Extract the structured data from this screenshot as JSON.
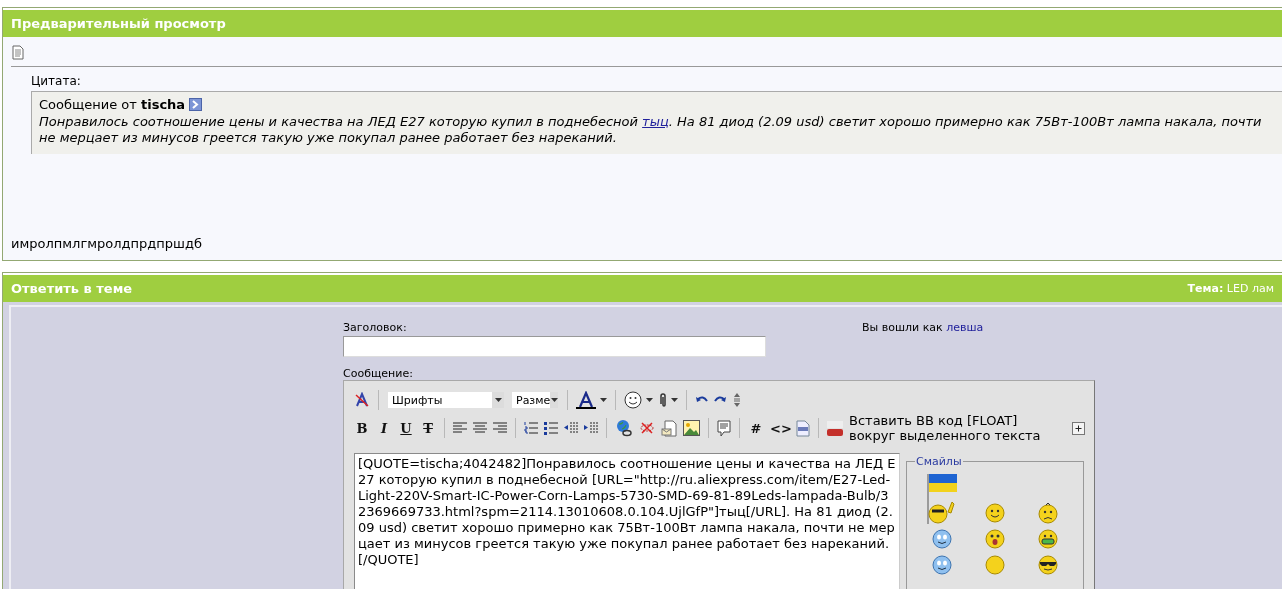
{
  "preview": {
    "title": "Предварительный просмотр",
    "quote_label": "Цитата:",
    "quote": {
      "from_label": "Сообщение от",
      "author": "tischa",
      "text_before": "Понравилось соотношение цены и качества на ЛЕД Е27 которую купил в поднебесной ",
      "link": "тыц",
      "text_after": ". На 81 диод (2.09 usd) светит хорошо примерно как 75Вт-100Вт лампа накала, почти не мерцает из минусов греется такую уже покупал ранее работает без нареканий."
    },
    "message": "имролпмлгмролдпрдпршдб"
  },
  "reply": {
    "title": "Ответить в теме",
    "topic": "**Тема:** LED лам",
    "title_label": "Заголовок:",
    "login_text": "Вы вошли как ",
    "login_user": "левша",
    "message_label": "Сообщение:",
    "editor": {
      "font_select": "Шрифты",
      "size_select": "Разме",
      "text_buttons": [
        "B",
        "I",
        "U",
        "T",
        "#",
        "<>"
      ],
      "float_hint": "Вставить BB код [FLOAT] вокруг выделенного текста",
      "value": "[QUOTE=tischa;4042482]Понравилось соотношение цены и качества на ЛЕД Е27 которую купил в поднебесной [URL=\"http://ru.aliexpress.com/item/E27-Led-Light-220V-Smart-IC-Power-Corn-Lamps-5730-SMD-69-81-89Leds-lampada-Bulb/32369669733.html?spm=2114.13010608.0.104.UjlGfP\"]тыц[/URL]. На 81 диод (2.09 usd) светит хорошо примерно как 75Вт-100Вт лампа накала, почти не мерцает из минусов греется такую уже покупал ранее работает без нареканий.\n[/QUOTE]",
      "smilies_label": "Смайлы"
    }
  }
}
